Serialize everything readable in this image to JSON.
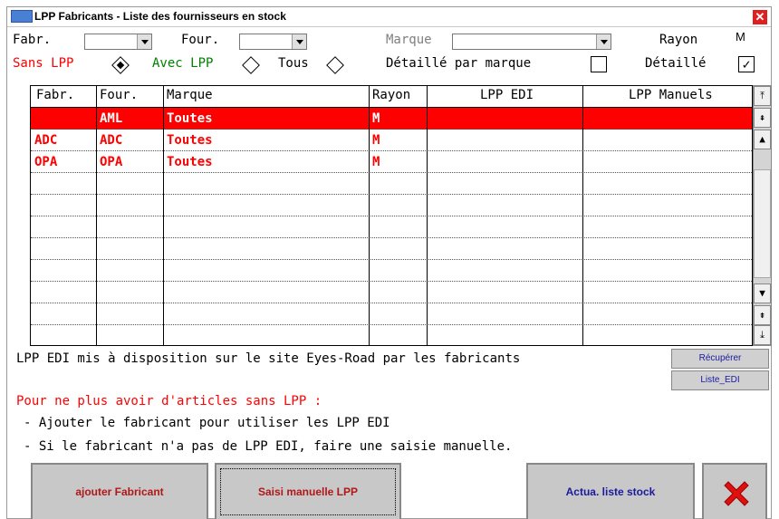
{
  "window": {
    "title": "LPP Fabricants - Liste des fournisseurs en stock",
    "close_icon": "close-icon"
  },
  "filters": {
    "fabr_label": "Fabr.",
    "fabr_value": "",
    "four_label": "Four.",
    "four_value": "",
    "marque_label": "Marque",
    "marque_value": "",
    "rayon_label": "Rayon",
    "rayon_value": "M"
  },
  "options": {
    "sans_lpp": "Sans LPP",
    "avec_lpp": "Avec LPP",
    "tous": "Tous",
    "selected": "Sans LPP",
    "detaille_marque": "Détaillé par marque",
    "detaille_marque_checked": false,
    "detaille": "Détaillé",
    "detaille_checked": true
  },
  "grid": {
    "columns": [
      "Fabr.",
      "Four.",
      "Marque",
      "Rayon",
      "LPP EDI",
      "LPP Manuels"
    ],
    "rows": [
      {
        "fabr": "",
        "four": "AML",
        "marque": "Toutes",
        "rayon": "M",
        "lpp_edi": "",
        "lpp_manuels": "",
        "selected": true
      },
      {
        "fabr": "ADC",
        "four": "ADC",
        "marque": "Toutes",
        "rayon": "M",
        "lpp_edi": "",
        "lpp_manuels": ""
      },
      {
        "fabr": "OPA",
        "four": "OPA",
        "marque": "Toutes",
        "rayon": "M",
        "lpp_edi": "",
        "lpp_manuels": ""
      }
    ]
  },
  "info": {
    "edi_text": "LPP EDI mis à disposition sur le site Eyes-Road par les fabricants",
    "recuperer": "Récupérer",
    "liste_edi": "Liste_EDI",
    "warning": "Pour ne plus avoir d'articles sans LPP :",
    "hint1": "- Ajouter le fabricant pour utiliser les LPP EDI",
    "hint2": "- Si le fabricant n'a pas de LPP EDI, faire une saisie manuelle."
  },
  "buttons": {
    "ajouter": "ajouter Fabricant",
    "saisie": "Saisi manuelle LPP",
    "actua": "Actua. liste stock"
  },
  "colors": {
    "accent_red": "#ff0000",
    "button_text_red": "#b01818",
    "button_text_blue": "#1a1aa0"
  }
}
